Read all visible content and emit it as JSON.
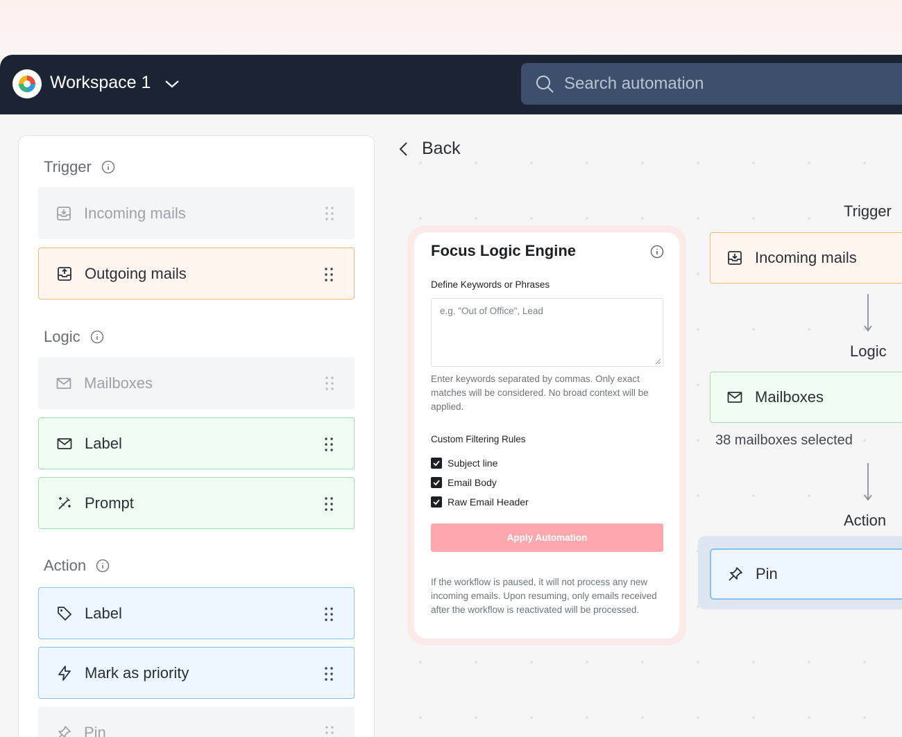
{
  "header": {
    "workspace": "Workspace 1",
    "search_placeholder": "Search automation"
  },
  "sidebar": {
    "trigger_title": "Trigger",
    "logic_title": "Logic",
    "action_title": "Action",
    "trigger_items": [
      {
        "label": "Incoming mails",
        "icon": "inbox-download-icon",
        "state": "disabled"
      },
      {
        "label": "Outgoing mails",
        "icon": "inbox-upload-icon",
        "state": "selected"
      }
    ],
    "logic_items": [
      {
        "label": "Mailboxes",
        "icon": "mail-icon",
        "state": "disabled"
      },
      {
        "label": "Label",
        "icon": "mail-icon",
        "state": "active"
      },
      {
        "label": "Prompt",
        "icon": "magic-wand-icon",
        "state": "active"
      }
    ],
    "action_items": [
      {
        "label": "Label",
        "icon": "tag-icon",
        "state": "active"
      },
      {
        "label": "Mark as priority",
        "icon": "lightning-icon",
        "state": "active"
      },
      {
        "label": "Pin",
        "icon": "pin-icon",
        "state": "disabled"
      }
    ]
  },
  "back_label": "Back",
  "card": {
    "title": "Focus Logic Engine",
    "keywords_label": "Define Keywords or Phrases",
    "keywords_placeholder": "e.g. \"Out of Office\", Lead",
    "keywords_hint": "Enter keywords separated by commas. Only exact matches will be considered. No broad context will be applied.",
    "rules_label": "Custom Filtering Rules",
    "rules": [
      {
        "label": "Subject line",
        "checked": true
      },
      {
        "label": "Email Body",
        "checked": true
      },
      {
        "label": "Raw Email Header",
        "checked": true
      }
    ],
    "apply_label": "Apply Automation",
    "footer_note": "If the workflow is paused, it will not process any new incoming emails. Upon resuming, only emails received after the workflow is reactivated will be processed."
  },
  "flow": {
    "trigger_label": "Trigger",
    "trigger_node": "Incoming mails",
    "logic_label": "Logic",
    "logic_node": "Mailboxes",
    "mailboxes_selected": "38 mailboxes selected",
    "action_label": "Action",
    "action_node": "Pin"
  },
  "colors": {
    "topbar": "#1b2433",
    "search": "#3d4f6c",
    "trigger_border": "#f6b774",
    "logic_border": "#9ee0ad",
    "action_border": "#87c1f2",
    "apply_button": "#fca8ae"
  }
}
